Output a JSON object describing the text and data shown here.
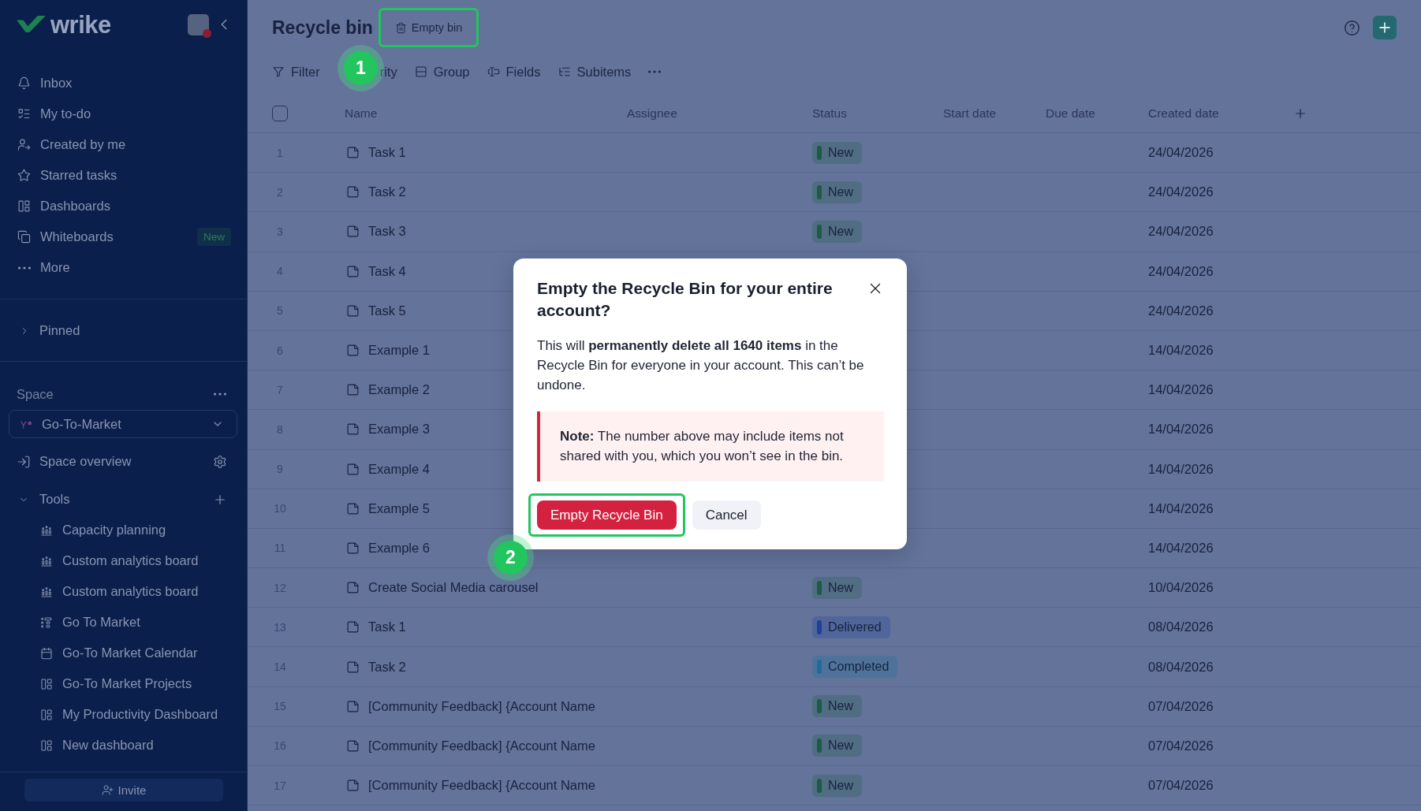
{
  "sidebar": {
    "logo": "wrike",
    "nav": [
      {
        "label": "Inbox"
      },
      {
        "label": "My to-do"
      },
      {
        "label": "Created by me"
      },
      {
        "label": "Starred tasks"
      },
      {
        "label": "Dashboards"
      },
      {
        "label": "Whiteboards",
        "badge": "New"
      },
      {
        "label": "More"
      }
    ],
    "pinned": {
      "label": "Pinned",
      "expanded": false
    },
    "space": {
      "label": "Space",
      "current": "Go-To-Market",
      "overview": "Space overview"
    },
    "tools": {
      "label": "Tools",
      "expanded": true,
      "children": [
        {
          "label": "Capacity planning",
          "kind": "report"
        },
        {
          "label": "Custom analytics board",
          "kind": "report"
        },
        {
          "label": "Custom analytics board",
          "kind": "report"
        },
        {
          "label": "Go To Market",
          "kind": "gantt"
        },
        {
          "label": "Go-To Market Calendar",
          "kind": "calendar"
        },
        {
          "label": "Go-To Market Projects",
          "kind": "dashboard"
        },
        {
          "label": "My Productivity Dashboard",
          "kind": "dashboard"
        },
        {
          "label": "New dashboard",
          "kind": "dashboard"
        }
      ]
    },
    "invite": "Invite"
  },
  "header": {
    "title": "Recycle bin",
    "empty_bin": {
      "label": "Empty bin",
      "highlighted": true,
      "step": "1"
    }
  },
  "toolbar": [
    "Filter",
    "rity",
    "Group",
    "Fields",
    "Subitems"
  ],
  "table": {
    "select_all": {
      "checked": false
    },
    "columns": [
      "Name",
      "Assignee",
      "Status",
      "Start date",
      "Due date",
      "Created date"
    ],
    "rows": [
      {
        "number": "1",
        "name": "Task 1",
        "status": {
          "label": "New",
          "color": "#1d5b45"
        },
        "created": "24/04/2026"
      },
      {
        "number": "2",
        "name": "Task 2",
        "status": {
          "label": "New",
          "color": "#1d5b45"
        },
        "created": "24/04/2026"
      },
      {
        "number": "3",
        "name": "Task 3",
        "status": {
          "label": "New",
          "color": "#1d5b45"
        },
        "created": "24/04/2026"
      },
      {
        "number": "4",
        "name": "Task 4",
        "created": "24/04/2026"
      },
      {
        "number": "5",
        "name": "Task 5",
        "created": "24/04/2026"
      },
      {
        "number": "6",
        "name": "Example 1",
        "created": "14/04/2026"
      },
      {
        "number": "7",
        "name": "Example 2",
        "created": "14/04/2026"
      },
      {
        "number": "8",
        "name": "Example 3",
        "created": "14/04/2026"
      },
      {
        "number": "9",
        "name": "Example 4",
        "created": "14/04/2026"
      },
      {
        "number": "10",
        "name": "Example 5",
        "created": "14/04/2026"
      },
      {
        "number": "11",
        "name": "Example 6",
        "created": "14/04/2026"
      },
      {
        "number": "12",
        "name": "Create Social Media carousel",
        "status": {
          "label": "New",
          "color": "#1d5b45"
        },
        "created": "10/04/2026"
      },
      {
        "number": "13",
        "name": "Task 1",
        "status": {
          "label": "Delivered",
          "color": "#1f3f9b"
        },
        "created": "08/04/2026"
      },
      {
        "number": "14",
        "name": "Task 2",
        "status": {
          "label": "Completed",
          "color": "#1b6e9c"
        },
        "created": "08/04/2026"
      },
      {
        "number": "15",
        "name": "[Community Feedback] {Account Name",
        "status": {
          "label": "New",
          "color": "#1d5b45"
        },
        "created": "07/04/2026"
      },
      {
        "number": "16",
        "name": "[Community Feedback] {Account Name",
        "status": {
          "label": "New",
          "color": "#1d5b45"
        },
        "created": "07/04/2026"
      },
      {
        "number": "17",
        "name": "[Community Feedback] {Account Name",
        "status": {
          "label": "New",
          "color": "#1d5b45"
        },
        "created": "07/04/2026"
      }
    ]
  },
  "dialog": {
    "title": "Empty the Recycle Bin for your entire account?",
    "body": "This will **permanently delete all 1640 items** in the Recycle Bin for everyone in your account. This can’t be undone.",
    "note": "**Note:** The number above may include items not shared with you, which you won’t see in the bin.",
    "buttons": [
      {
        "label": "Empty Recycle Bin",
        "kind": "danger",
        "highlighted": true,
        "step": "2"
      },
      {
        "label": "Cancel",
        "kind": "secondary",
        "highlighted": false
      }
    ]
  }
}
